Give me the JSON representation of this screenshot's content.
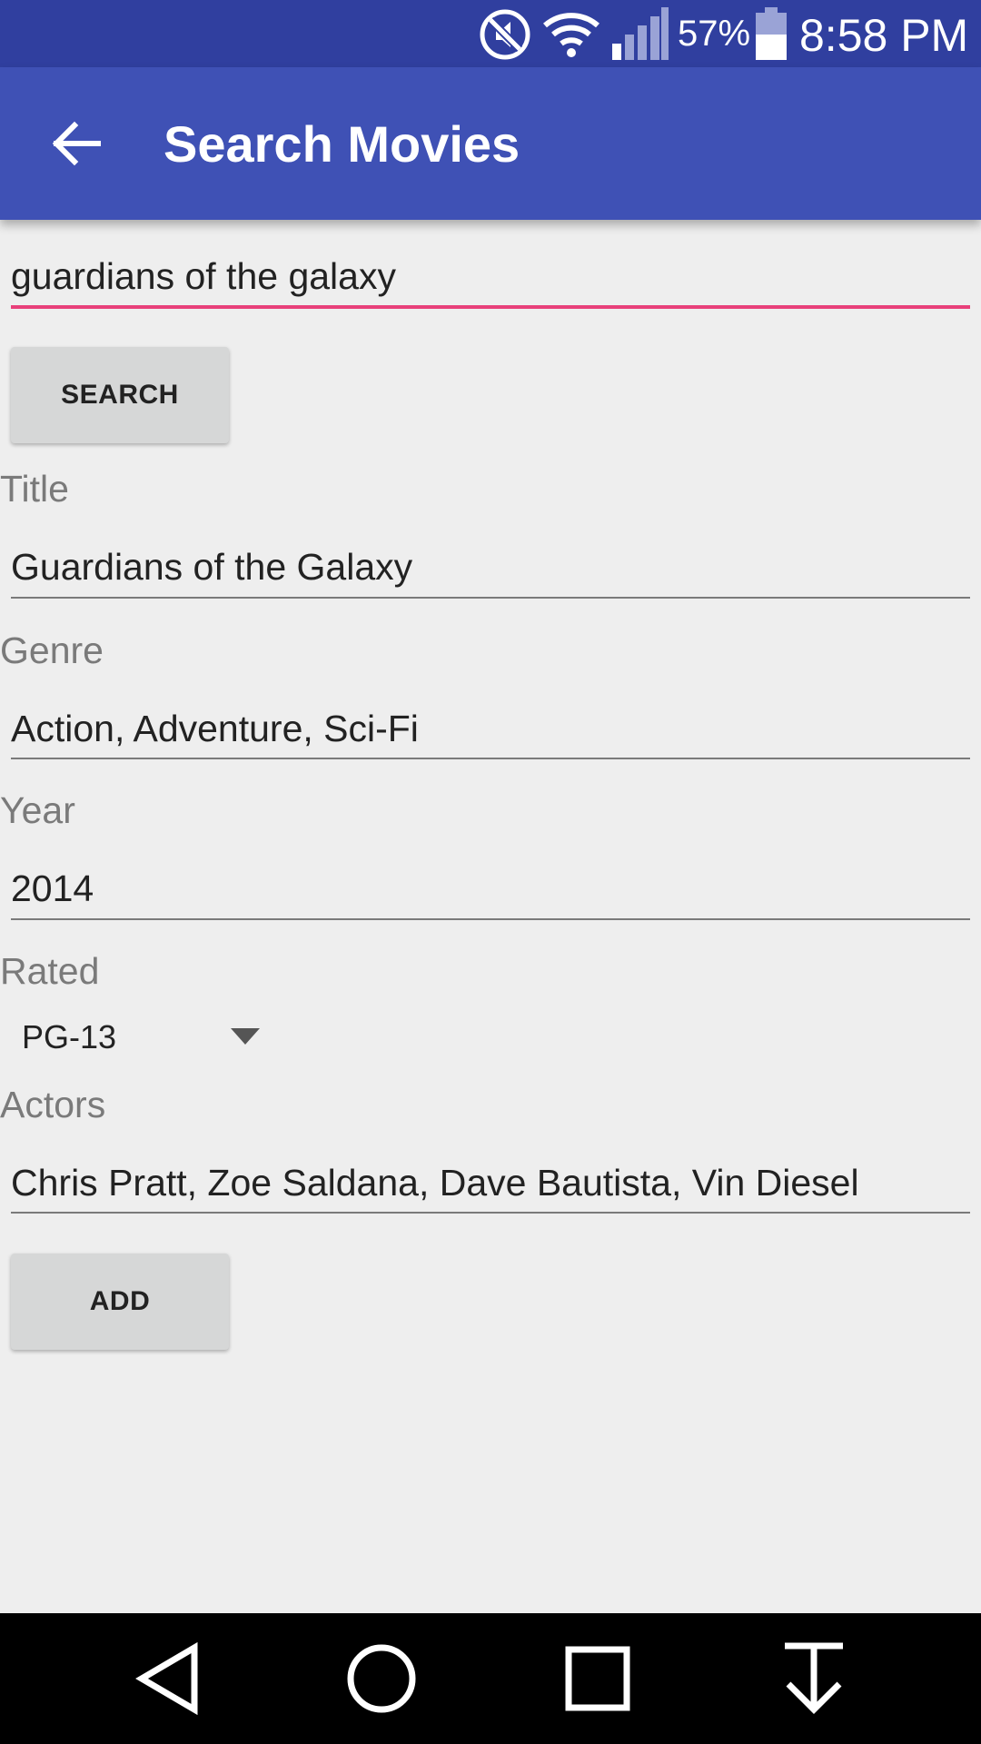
{
  "status_bar": {
    "icons": [
      "mute-icon",
      "wifi-icon",
      "signal-icon",
      "battery-icon"
    ],
    "battery_percent": "57%",
    "time": "8:58 PM"
  },
  "app_bar": {
    "back_icon": "arrow-back-icon",
    "title": "Search Movies"
  },
  "search": {
    "query": "guardians of the galaxy",
    "button_label": "SEARCH"
  },
  "fields": {
    "title": {
      "label": "Title",
      "value": "Guardians of the Galaxy"
    },
    "genre": {
      "label": "Genre",
      "value": "Action, Adventure, Sci-Fi"
    },
    "year": {
      "label": "Year",
      "value": "2014"
    },
    "rated": {
      "label": "Rated",
      "selected": "PG-13"
    },
    "actors": {
      "label": "Actors",
      "value": "Chris Pratt, Zoe Saldana, Dave Bautista, Vin Diesel"
    }
  },
  "add_button_label": "ADD",
  "nav_bar": {
    "icons": [
      "nav-back-icon",
      "nav-home-icon",
      "nav-recents-icon",
      "nav-download-icon"
    ]
  },
  "colors": {
    "status_bar": "#303f9f",
    "app_bar": "#3f51b5",
    "accent": "#e8407a",
    "background": "#eeeeee"
  }
}
